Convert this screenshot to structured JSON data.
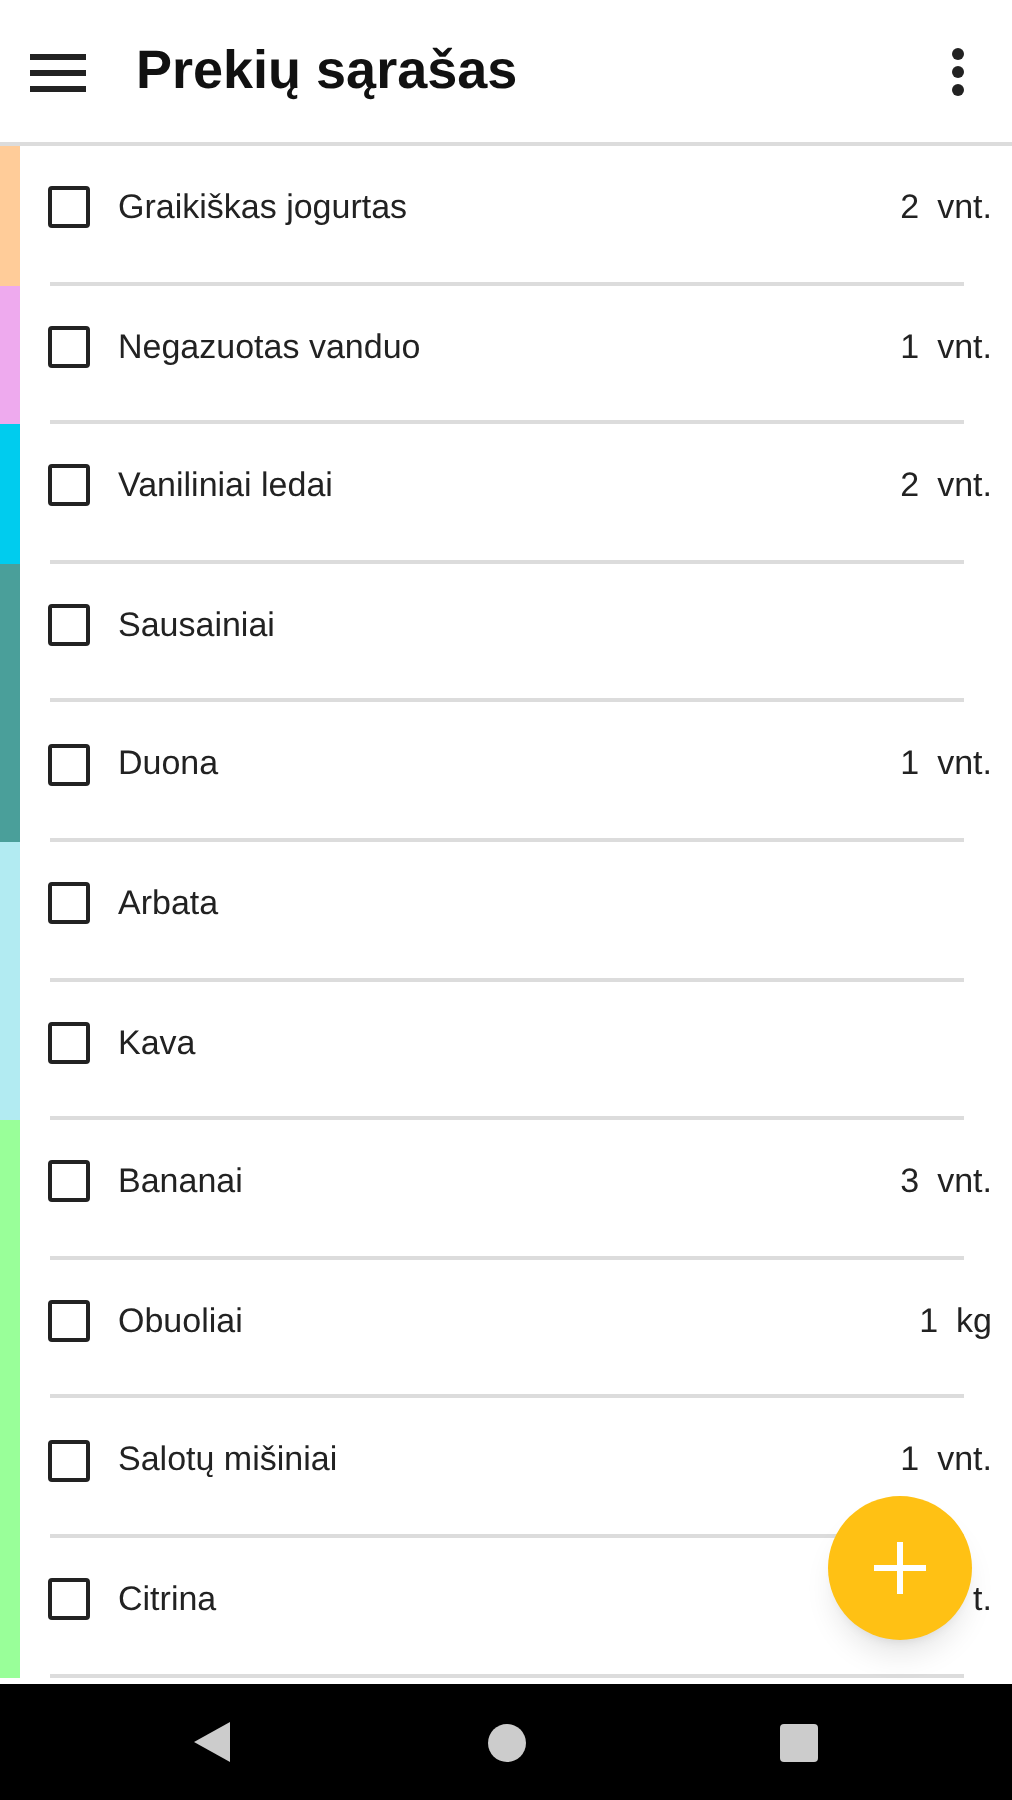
{
  "app_bar": {
    "title": "Prekių sąrašas"
  },
  "items": [
    {
      "name": "Graikiškas jogurtas",
      "checked": false,
      "amount": "2",
      "unit": "vnt.",
      "color": "#ffcc99"
    },
    {
      "name": "Negazuotas vanduo",
      "checked": false,
      "amount": "1",
      "unit": "vnt.",
      "color": "#eeaaee"
    },
    {
      "name": "Vaniliniai ledai",
      "checked": false,
      "amount": "2",
      "unit": "vnt.",
      "color": "#00ccee"
    },
    {
      "name": "Sausainiai",
      "checked": false,
      "color": "#4a9f9a"
    },
    {
      "name": "Duona",
      "checked": false,
      "amount": "1",
      "unit": "vnt.",
      "color": "#4a9f9a"
    },
    {
      "name": "Arbata",
      "checked": false,
      "color": "#b2ebf2"
    },
    {
      "name": "Kava",
      "checked": false,
      "color": "#b2ebf2"
    },
    {
      "name": "Bananai",
      "checked": false,
      "amount": "3",
      "unit": "vnt.",
      "color": "#99ff99"
    },
    {
      "name": "Obuoliai",
      "checked": false,
      "amount": "1",
      "unit": "kg",
      "color": "#99ff99"
    },
    {
      "name": "Salotų mišiniai",
      "checked": false,
      "amount": "1",
      "unit": "vnt.",
      "color": "#99ff99"
    },
    {
      "name": "Citrina",
      "checked": false,
      "unit": "t.",
      "color": "#99ff99"
    }
  ]
}
